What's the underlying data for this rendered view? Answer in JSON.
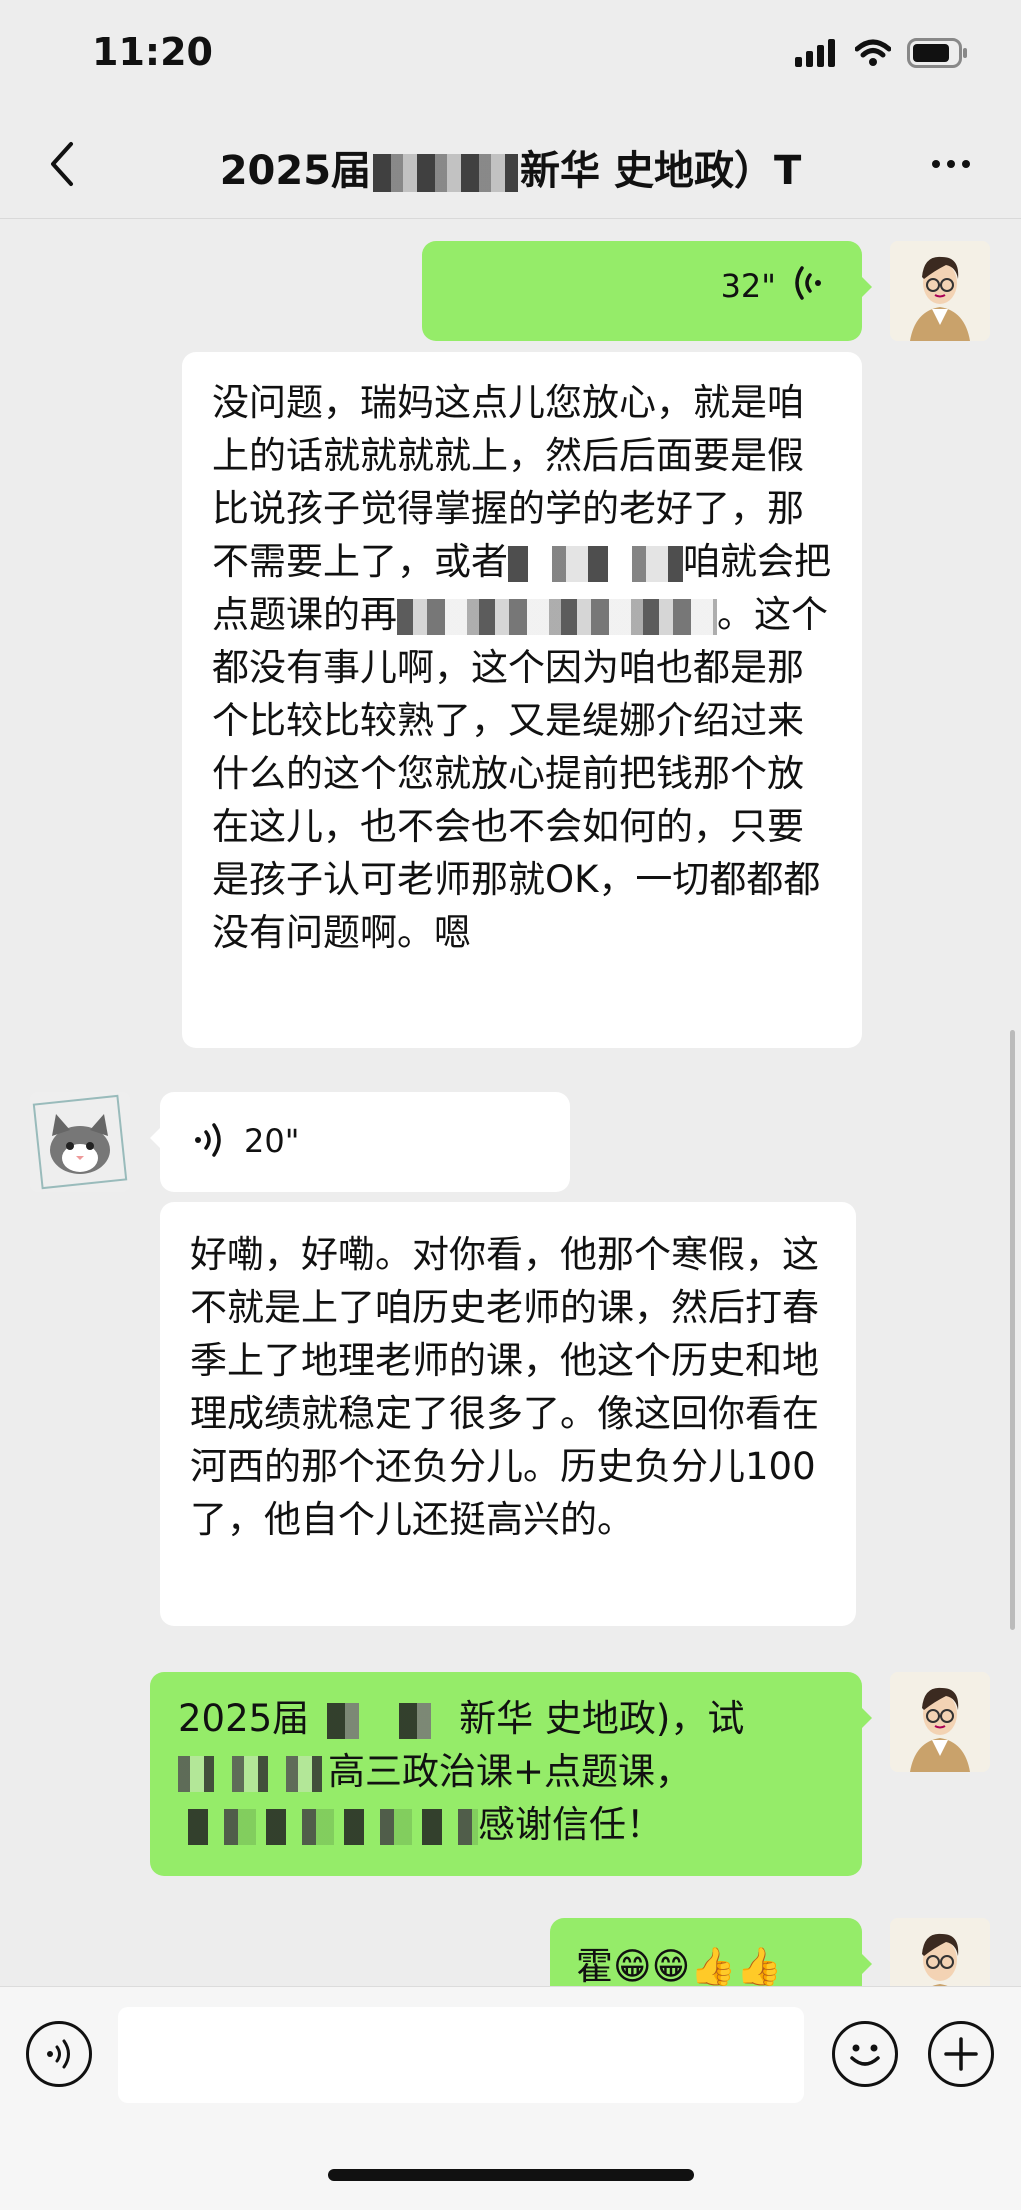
{
  "status_bar": {
    "time": "11:20"
  },
  "header": {
    "title_prefix": "2025届",
    "title_suffix": "新华 史地政）T"
  },
  "messages": {
    "m1_voice_duration": "32\"",
    "m2_text": "没问题，瑞妈这点儿您放心，就是咱上的话就就就就上，然后后面要是假比说孩子觉得掌握的学的老好了，那不需要上了，或者",
    "m2_text_b": "咱就会把点题课的再",
    "m2_text_c": "。这个都没有事儿啊，这个因为咱也都是那个比较比较熟了，又是缇娜介绍过来什么的这个您就放心提前把钱那个放在这儿，也不会也不会如何的，只要是孩子认可老师那就OK，一切都都都没有问题啊。嗯",
    "m3_voice_duration": "20\"",
    "m4_text": "好嘞，好嘞。对你看，他那个寒假，这不就是上了咱历史老师的课，然后打春季上了地理老师的课，他这个历史和地理成绩就稳定了很多了。像这回你看在河西的那个还负分儿。历史负分儿100了，他自个儿还挺高兴的。",
    "m5_line1_a": "2025届",
    "m5_line1_b": "新华 史地政)，试",
    "m5_line2": "高三政治课+点题课，",
    "m5_line3": "感谢信任！",
    "m6_text": "霍😁😁👍👍"
  },
  "input_bar": {
    "placeholder": ""
  },
  "colors": {
    "outgoing_bubble": "#95ec69",
    "incoming_bubble": "#ffffff",
    "background": "#ededed"
  },
  "icons": [
    "signal-icon",
    "wifi-icon",
    "battery-icon",
    "back-icon",
    "more-icon",
    "voice-wave-icon",
    "voice-toggle-icon",
    "emoji-icon",
    "plus-icon"
  ]
}
